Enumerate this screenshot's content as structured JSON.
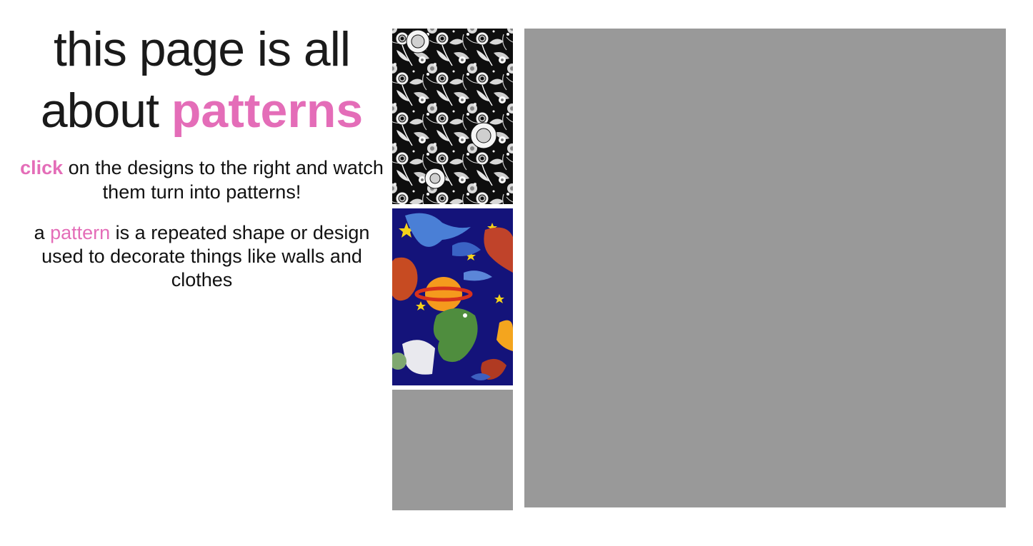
{
  "intro": {
    "headline_line1": "this page is all",
    "headline_line2_prefix": "about ",
    "headline_accent": "patterns",
    "para1_accent": "click",
    "para1_rest": " on the designs to the right and watch them turn into patterns!",
    "para2_prefix": "a ",
    "para2_accent": "pattern",
    "para2_rest": " is a repeated shape or design used to decorate things like walls and clothes"
  },
  "thumbnails": [
    {
      "name": "floral-pattern-thumbnail",
      "style": "black and white floral"
    },
    {
      "name": "dinosaur-pattern-thumbnail",
      "style": "dinosaurs in space"
    },
    {
      "name": "blank-pattern-thumbnail",
      "style": "grey placeholder"
    }
  ],
  "colors": {
    "accent": "#e46db8",
    "placeholder": "#999999",
    "text": "#111111",
    "background": "#ffffff"
  }
}
